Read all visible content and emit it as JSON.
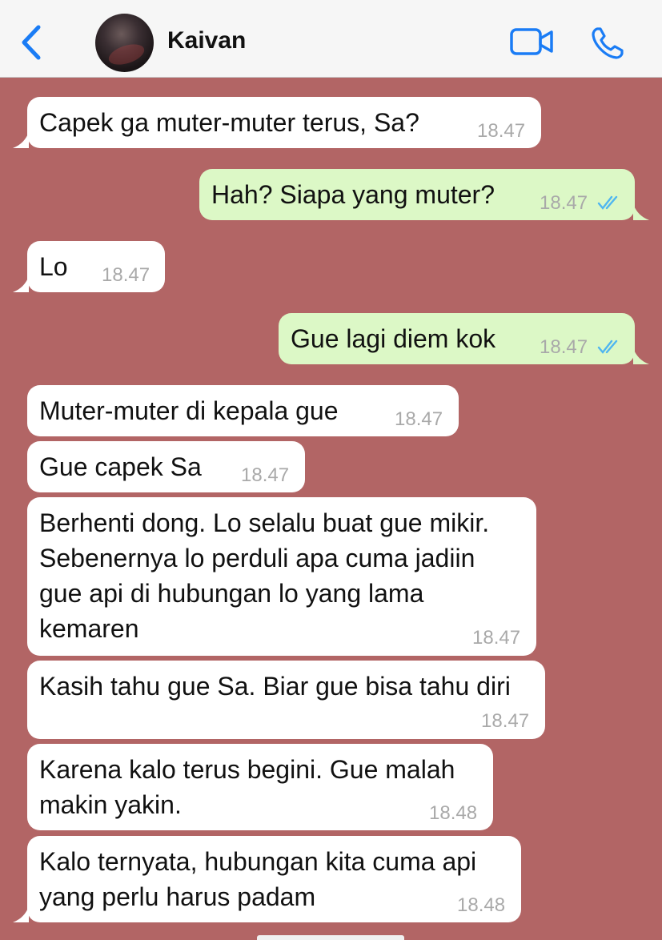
{
  "header": {
    "contact_name": "Kaivan",
    "icons": [
      "back-chevron-icon",
      "avatar",
      "video-camera-icon",
      "phone-icon"
    ],
    "accent": "#1a7cf5"
  },
  "colors": {
    "background": "#b26565",
    "incoming_bubble": "#ffffff",
    "outgoing_bubble": "#dcf8c6",
    "read_ticks": "#4fb6f0",
    "timestamp": "#a9a9a9"
  },
  "messages": [
    {
      "dir": "in",
      "text": "Capek ga muter-muter terus, Sa?",
      "time": "18.47"
    },
    {
      "dir": "out",
      "text": "Hah? Siapa yang muter?",
      "time": "18.47",
      "status": "read"
    },
    {
      "dir": "in",
      "text": "Lo",
      "time": "18.47"
    },
    {
      "dir": "out",
      "text": "Gue lagi diem kok",
      "time": "18.47",
      "status": "read"
    },
    {
      "dir": "in",
      "text": "Muter-muter di kepala gue",
      "time": "18.47"
    },
    {
      "dir": "in",
      "text": "Gue capek Sa",
      "time": "18.47"
    },
    {
      "dir": "in",
      "text": "Berhenti dong. Lo selalu buat gue mikir.\nSebenernya lo perduli apa cuma jadiin\ngue api di hubungan lo yang lama\nkemaren",
      "time": "18.47"
    },
    {
      "dir": "in",
      "text": "Kasih tahu gue Sa. Biar gue bisa tahu diri",
      "time": "18.47"
    },
    {
      "dir": "in",
      "text": "Karena kalo terus begini. Gue malah\nmakin yakin.",
      "time": "18.48"
    },
    {
      "dir": "in",
      "text": "Kalo ternyata, hubungan kita cuma api\nyang perlu harus padam",
      "time": "18.48"
    }
  ]
}
